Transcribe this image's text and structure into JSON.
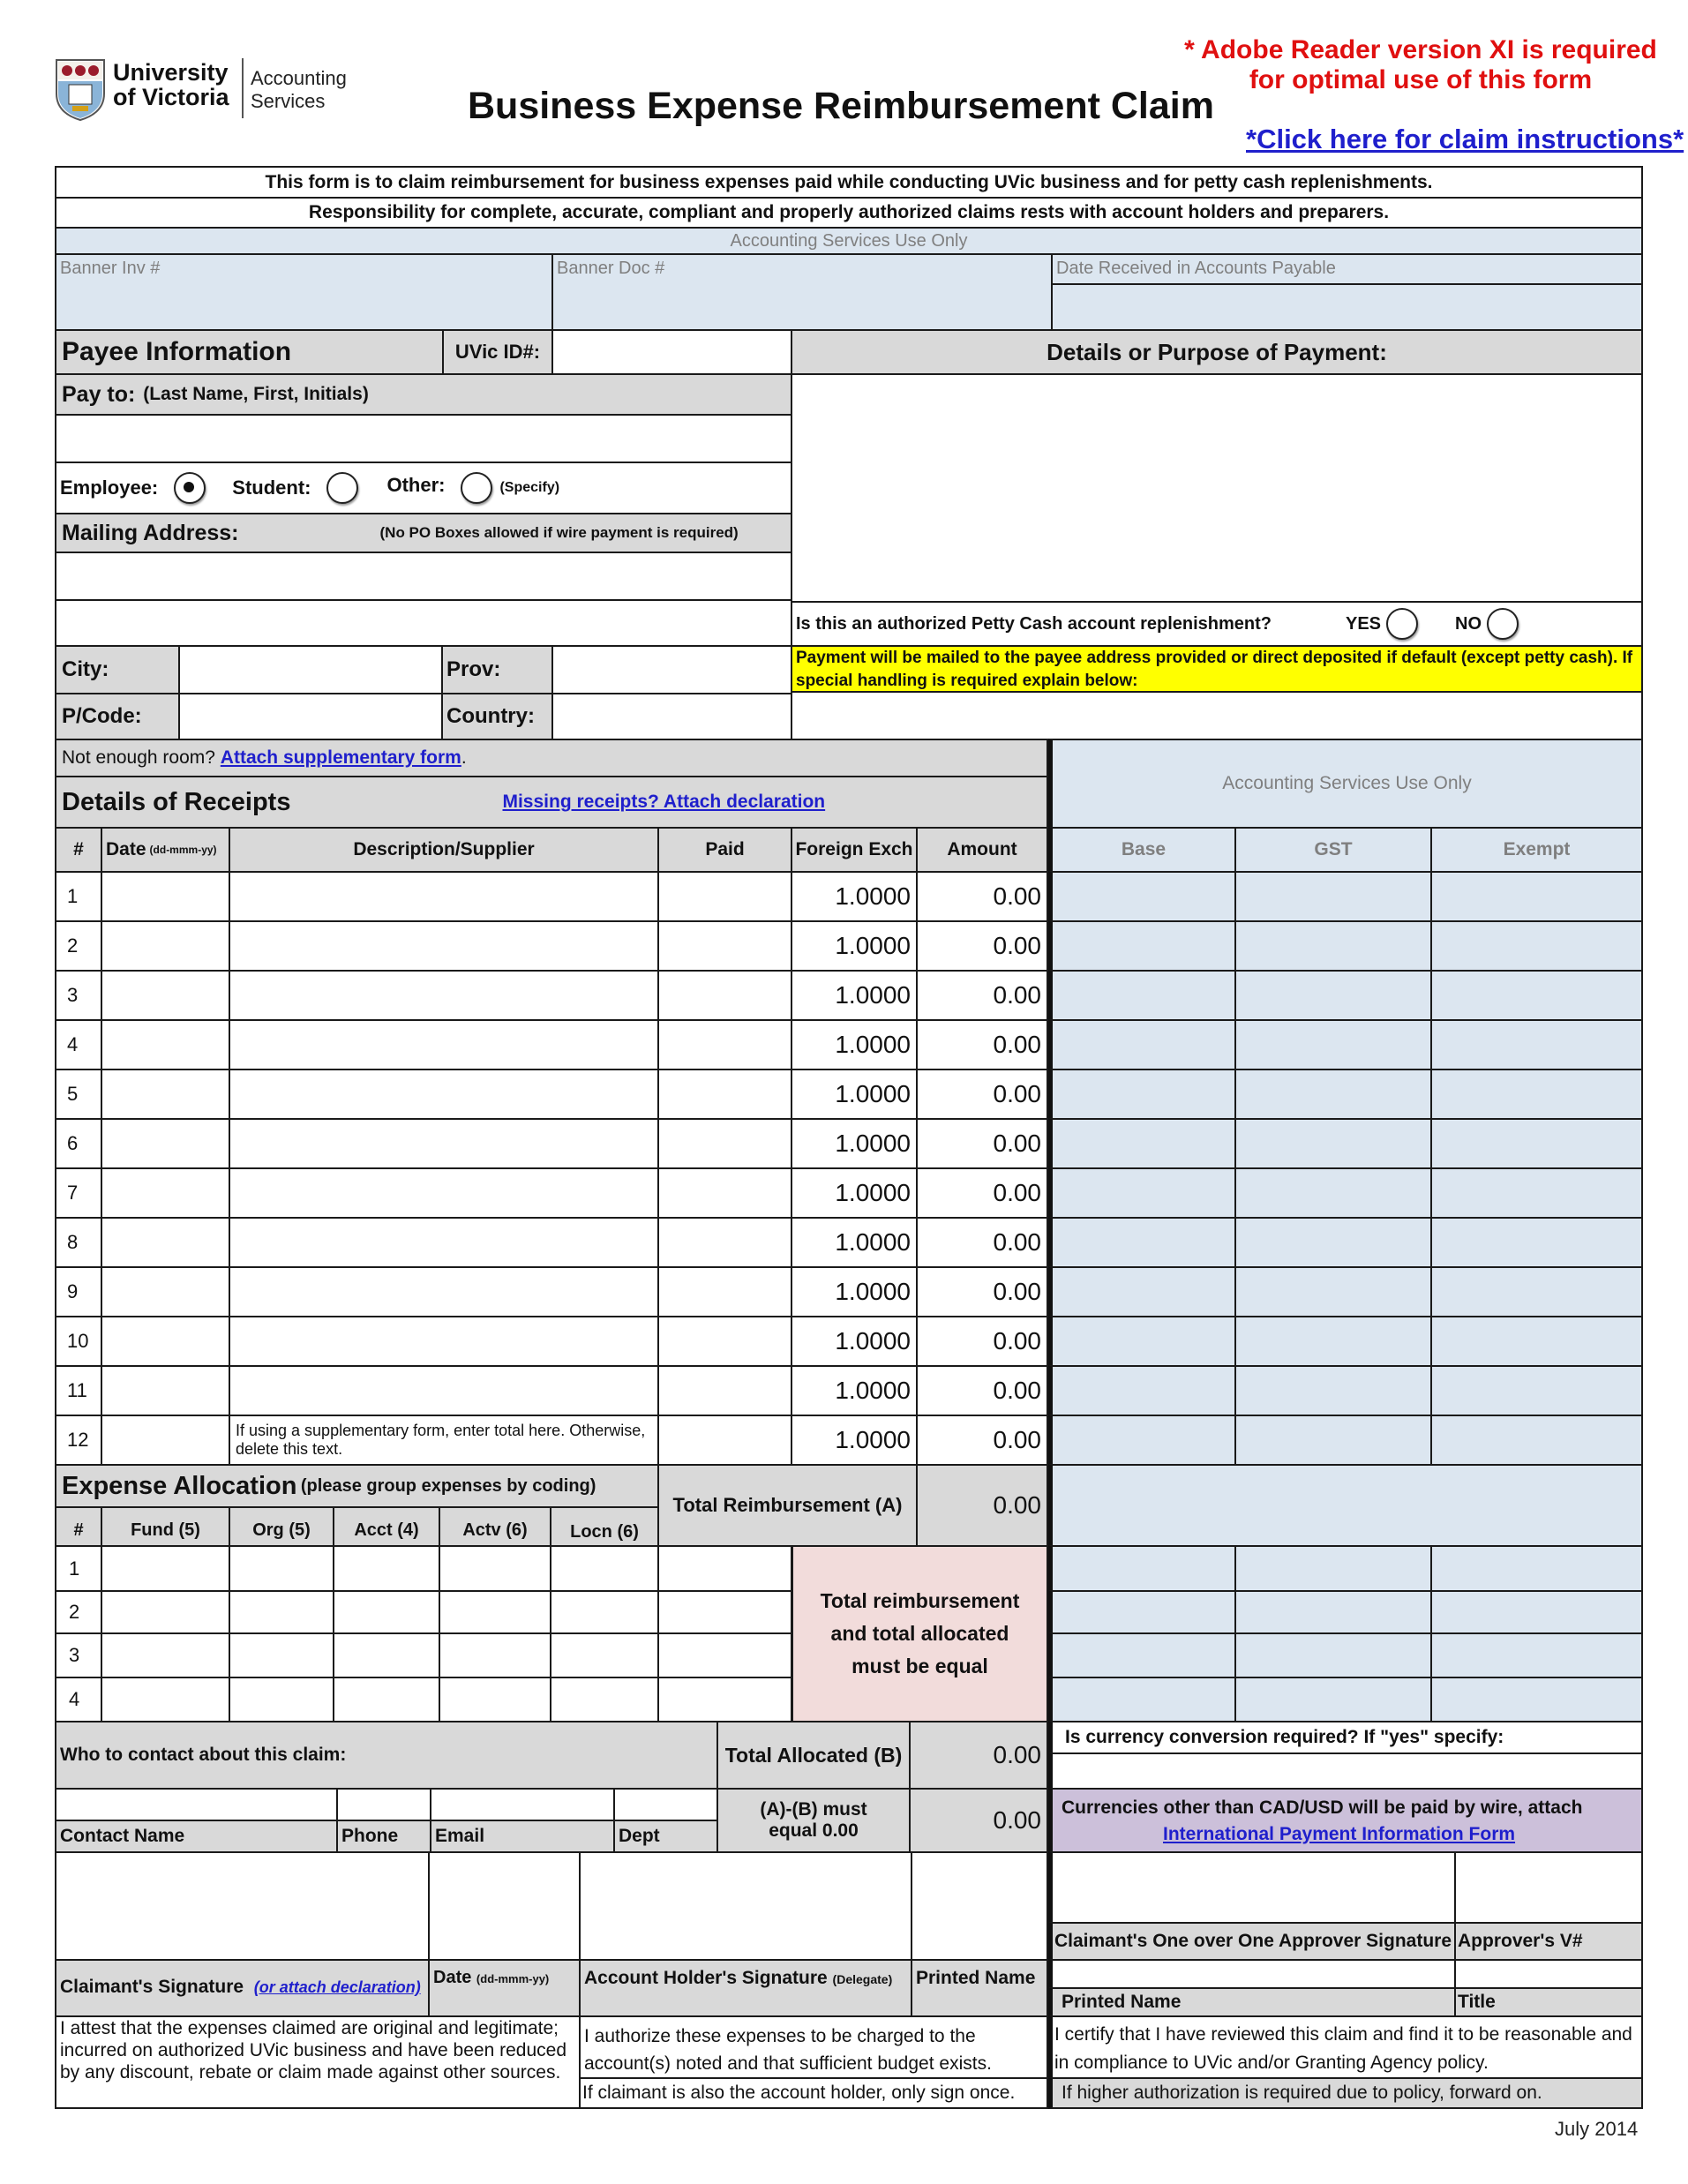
{
  "header": {
    "logo": {
      "line1": "University",
      "line2": "of Victoria",
      "dept1": "Accounting",
      "dept2": "Services",
      "icon": "uvic-crest-icon"
    },
    "title": "Business Expense Reimbursement Claim",
    "adobe_notice_line1": "Adobe Reader version XI is required",
    "adobe_notice_line2": "for optimal use of this form",
    "asterisk": "*",
    "instructions_link": "*Click here for claim instructions*"
  },
  "intro": {
    "line1": "This form is to claim reimbursement for business expenses paid while conducting UVic business and for petty cash replenishments.",
    "line2": "Responsibility for complete, accurate, compliant and properly authorized claims rests with account holders and preparers.",
    "asu_label": "Accounting Services Use Only",
    "banner_inv": "Banner Inv #",
    "banner_doc": "Banner Doc #",
    "date_received": "Date Received in Accounts Payable"
  },
  "payee": {
    "title": "Payee Information",
    "uvic_id_label": "UVic ID#:",
    "uvic_id_value": "",
    "pay_to_label": "Pay to:",
    "pay_to_hint": "(Last Name, First, Initials)",
    "pay_to_value": "",
    "types": [
      {
        "label": "Employee:",
        "selected": true
      },
      {
        "label": "Student:",
        "selected": false
      },
      {
        "label": "Other:",
        "selected": false
      }
    ],
    "specify": "(Specify)",
    "mailing_label": "Mailing Address:",
    "mailing_note": "(No PO Boxes allowed if wire payment is required)",
    "city_label": "City:",
    "prov_label": "Prov:",
    "pcode_label": "P/Code:",
    "country_label": "Country:"
  },
  "details": {
    "title": "Details or Purpose of Payment:",
    "petty_cash_question": "Is this an authorized Petty Cash account replenishment?",
    "yes": "YES",
    "no": "NO",
    "payment_note": "Payment will be mailed to the payee address provided or direct deposited if default (except petty cash). If special handling is required explain below:"
  },
  "receipts": {
    "not_enough_room": "Not enough room?",
    "supplementary_link": "Attach supplementary form",
    "period": ".",
    "title": "Details of Receipts",
    "missing_link": "Missing receipts? Attach declaration",
    "asu_label": "Accounting Services Use Only",
    "columns": {
      "num": "#",
      "date": "Date",
      "date_fmt": "(dd-mmm-yy)",
      "desc": "Description/Supplier",
      "paid": "Paid",
      "fx": "Foreign Exch",
      "amount": "Amount",
      "base": "Base",
      "gst": "GST",
      "exempt": "Exempt"
    },
    "rows": [
      {
        "n": "1",
        "fx": "1.0000",
        "amount": "0.00",
        "desc": ""
      },
      {
        "n": "2",
        "fx": "1.0000",
        "amount": "0.00",
        "desc": ""
      },
      {
        "n": "3",
        "fx": "1.0000",
        "amount": "0.00",
        "desc": ""
      },
      {
        "n": "4",
        "fx": "1.0000",
        "amount": "0.00",
        "desc": ""
      },
      {
        "n": "5",
        "fx": "1.0000",
        "amount": "0.00",
        "desc": ""
      },
      {
        "n": "6",
        "fx": "1.0000",
        "amount": "0.00",
        "desc": ""
      },
      {
        "n": "7",
        "fx": "1.0000",
        "amount": "0.00",
        "desc": ""
      },
      {
        "n": "8",
        "fx": "1.0000",
        "amount": "0.00",
        "desc": ""
      },
      {
        "n": "9",
        "fx": "1.0000",
        "amount": "0.00",
        "desc": ""
      },
      {
        "n": "10",
        "fx": "1.0000",
        "amount": "0.00",
        "desc": ""
      },
      {
        "n": "11",
        "fx": "1.0000",
        "amount": "0.00",
        "desc": ""
      },
      {
        "n": "12",
        "fx": "1.0000",
        "amount": "0.00",
        "desc": "If using a supplementary form, enter total here. Otherwise, delete this text."
      }
    ]
  },
  "allocation": {
    "title": "Expense Allocation",
    "subtitle": "(please group expenses by coding)",
    "columns": [
      "#",
      "Fund (5)",
      "Org (5)",
      "Acct (4)",
      "Actv (6)",
      "Locn (6)"
    ],
    "rows": [
      "1",
      "2",
      "3",
      "4"
    ],
    "total_reimb_label": "Total Reimbursement (A)",
    "total_reimb_value": "0.00",
    "equal_note": "Total reimbursement and total allocated must be equal",
    "total_alloc_label": "Total Allocated (B)",
    "total_alloc_value": "0.00",
    "diff_label": "(A)-(B) must equal 0.00",
    "diff_value": "0.00"
  },
  "contact": {
    "title": "Who to contact about this claim:",
    "name": "Contact Name",
    "phone": "Phone",
    "email": "Email",
    "dept": "Dept"
  },
  "currency": {
    "question": "Is currency conversion required? If \"yes\" specify:",
    "wire_note": "Currencies other than CAD/USD will be paid by wire, attach",
    "ipi_link": "International Payment  Information Form"
  },
  "signatures": {
    "claimant": "Claimant's Signature",
    "claimant_link": "(or attach declaration)",
    "date": "Date",
    "date_fmt": "(dd-mmm-yy)",
    "account_holder": "Account Holder's Signature",
    "delegate": "(Delegate)",
    "printed_name": "Printed Name",
    "approver_sig": "Claimant's One over One Approver Signature",
    "approver_v": "Approver's V#",
    "approver_printed": "Printed Name",
    "approver_title": "Title",
    "attest": "I attest that the expenses claimed are original and legitimate; incurred on authorized UVic business and have been reduced by any discount, rebate or claim made against other sources.",
    "authorize": "I authorize these expenses to be charged to the account(s) noted and that sufficient budget exists.",
    "sign_once": "If claimant is also the account holder, only sign once.",
    "certify": "I certify that I have reviewed this claim and find it to be reasonable and in compliance to UVic and/or Granting Agency policy.",
    "forward": "If higher authorization is required due to policy, forward on."
  },
  "footer": {
    "version": "July 2014"
  },
  "colors": {
    "grey_fill": "#d9d9d9",
    "asu_fill": "#dce6f0",
    "note_yellow": "#ffff00",
    "pink_fill": "#f2dcdb",
    "purple_fill": "#ccc0da",
    "link_blue": "#1f1fcc",
    "notice_red": "#e01010"
  }
}
